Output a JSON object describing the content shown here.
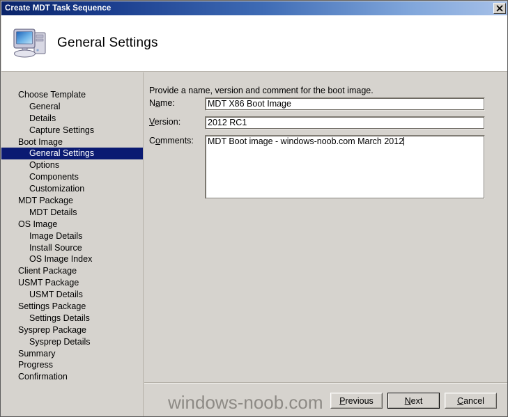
{
  "window": {
    "title": "Create MDT Task Sequence",
    "close_icon": "close-x-icon"
  },
  "header": {
    "icon": "computer-monitor-icon",
    "title": "General Settings"
  },
  "sidebar": {
    "items": [
      {
        "label": "Choose Template",
        "level": 0,
        "selected": false
      },
      {
        "label": "General",
        "level": 1,
        "selected": false
      },
      {
        "label": "Details",
        "level": 1,
        "selected": false
      },
      {
        "label": "Capture Settings",
        "level": 1,
        "selected": false
      },
      {
        "label": "Boot Image",
        "level": 0,
        "selected": false
      },
      {
        "label": "General Settings",
        "level": 1,
        "selected": true
      },
      {
        "label": "Options",
        "level": 1,
        "selected": false
      },
      {
        "label": "Components",
        "level": 1,
        "selected": false
      },
      {
        "label": "Customization",
        "level": 1,
        "selected": false
      },
      {
        "label": "MDT Package",
        "level": 0,
        "selected": false
      },
      {
        "label": "MDT Details",
        "level": 1,
        "selected": false
      },
      {
        "label": "OS Image",
        "level": 0,
        "selected": false
      },
      {
        "label": "Image Details",
        "level": 1,
        "selected": false
      },
      {
        "label": "Install Source",
        "level": 1,
        "selected": false
      },
      {
        "label": "OS Image Index",
        "level": 1,
        "selected": false
      },
      {
        "label": "Client Package",
        "level": 0,
        "selected": false
      },
      {
        "label": "USMT Package",
        "level": 0,
        "selected": false
      },
      {
        "label": "USMT Details",
        "level": 1,
        "selected": false
      },
      {
        "label": "Settings Package",
        "level": 0,
        "selected": false
      },
      {
        "label": "Settings Details",
        "level": 1,
        "selected": false
      },
      {
        "label": "Sysprep Package",
        "level": 0,
        "selected": false
      },
      {
        "label": "Sysprep Details",
        "level": 1,
        "selected": false
      },
      {
        "label": "Summary",
        "level": 0,
        "selected": false
      },
      {
        "label": "Progress",
        "level": 0,
        "selected": false
      },
      {
        "label": "Confirmation",
        "level": 0,
        "selected": false
      }
    ]
  },
  "main": {
    "intro": "Provide a name, version and comment for the boot image.",
    "fields": {
      "name": {
        "label_prefix": "N",
        "label_accesskey": "a",
        "label_suffix": "me:",
        "value": "MDT X86 Boot Image"
      },
      "version": {
        "label_prefix": "",
        "label_accesskey": "V",
        "label_suffix": "ersion:",
        "value": "2012 RC1"
      },
      "comments": {
        "label_prefix": "C",
        "label_accesskey": "o",
        "label_suffix": "mments:",
        "value": "MDT Boot image - windows-noob.com March 2012"
      }
    }
  },
  "footer": {
    "buttons": [
      {
        "name": "previous",
        "prefix": "",
        "accesskey": "P",
        "suffix": "revious",
        "default": false
      },
      {
        "name": "next",
        "prefix": "",
        "accesskey": "N",
        "suffix": "ext",
        "default": true
      },
      {
        "name": "cancel",
        "prefix": "",
        "accesskey": "C",
        "suffix": "ancel",
        "default": false
      }
    ]
  },
  "watermark": {
    "text": "windows-noob.com"
  },
  "colors": {
    "titlebar_start": "#0a246a",
    "titlebar_end": "#a7c1e8",
    "dialog_face": "#d6d3ce",
    "selection": "#0a1a72",
    "header_bg": "#ffffff"
  }
}
